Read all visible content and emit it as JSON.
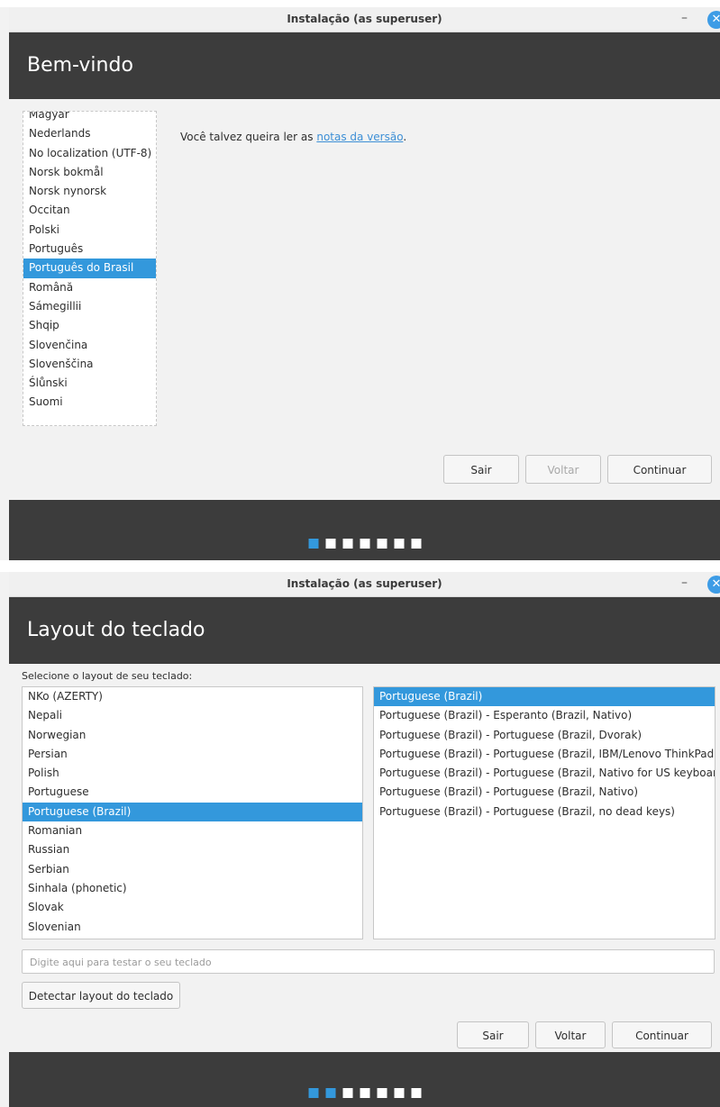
{
  "window_title": "Instalação (as superuser)",
  "welcome": {
    "header_title": "Bem-vindo",
    "languages": [
      "Magyar",
      "Nederlands",
      "No localization (UTF-8)",
      "Norsk bokmål",
      "Norsk nynorsk",
      "Occitan",
      "Polski",
      "Português",
      "Português do Brasil",
      "Română",
      "Sámegillii",
      "Shqip",
      "Slovenčina",
      "Slovenščina",
      "Ślůnski",
      "Suomi"
    ],
    "selected_language": "Português do Brasil",
    "release_notes_prefix": "Você talvez queira ler as ",
    "release_notes_link": "notas da versão",
    "release_notes_suffix": ".",
    "buttons": {
      "quit": "Sair",
      "back": "Voltar",
      "continue": "Continuar"
    },
    "step": 1,
    "total_steps": 7
  },
  "keyboard": {
    "header_title": "Layout do teclado",
    "prompt": "Selecione o layout de seu teclado:",
    "layouts": [
      "NKo (AZERTY)",
      "Nepali",
      "Norwegian",
      "Persian",
      "Polish",
      "Portuguese",
      "Portuguese (Brazil)",
      "Romanian",
      "Russian",
      "Serbian",
      "Sinhala (phonetic)",
      "Slovak",
      "Slovenian"
    ],
    "selected_layout": "Portuguese (Brazil)",
    "variants": [
      "Portuguese (Brazil)",
      "Portuguese (Brazil) - Esperanto (Brazil, Nativo)",
      "Portuguese (Brazil) - Portuguese (Brazil, Dvorak)",
      "Portuguese (Brazil) - Portuguese (Brazil, IBM/Lenovo ThinkPad)",
      "Portuguese (Brazil) - Portuguese (Brazil, Nativo for US keyboards)",
      "Portuguese (Brazil) - Portuguese (Brazil, Nativo)",
      "Portuguese (Brazil) - Portuguese (Brazil, no dead keys)"
    ],
    "selected_variant": "Portuguese (Brazil)",
    "test_placeholder": "Digite aqui para testar o seu teclado",
    "detect_button": "Detectar layout do teclado",
    "buttons": {
      "quit": "Sair",
      "back": "Voltar",
      "continue": "Continuar"
    },
    "step": 2,
    "total_steps": 7
  },
  "colors": {
    "accent": "#3398dc",
    "header_bg": "#3c3c3c"
  }
}
